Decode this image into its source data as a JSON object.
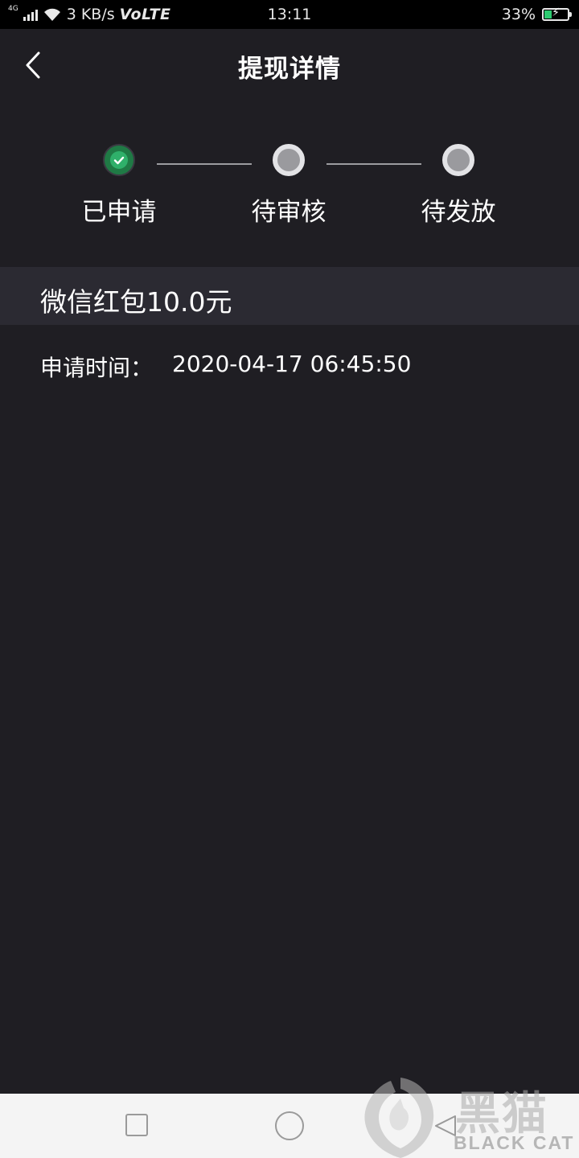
{
  "status_bar": {
    "network_type": "4G",
    "speed": "3 KB/s",
    "volte": "VoLTE",
    "time": "13:11",
    "battery_percent": "33%",
    "battery_level": 0.33
  },
  "header": {
    "title": "提现详情"
  },
  "steps": [
    {
      "label": "已申请",
      "status": "done"
    },
    {
      "label": "待审核",
      "status": "pending"
    },
    {
      "label": "待发放",
      "status": "pending"
    }
  ],
  "detail": {
    "amount_text": "微信红包10.0元",
    "apply_time_label": "申请时间：",
    "apply_time_value": "2020-04-17 06:45:50"
  },
  "watermark": {
    "logo_text": "黑猫",
    "brand_text": "BLACK CAT"
  },
  "colors": {
    "background": "#1f1e23",
    "done_green": "#2fb06a",
    "row_background": "#2b2a32"
  }
}
